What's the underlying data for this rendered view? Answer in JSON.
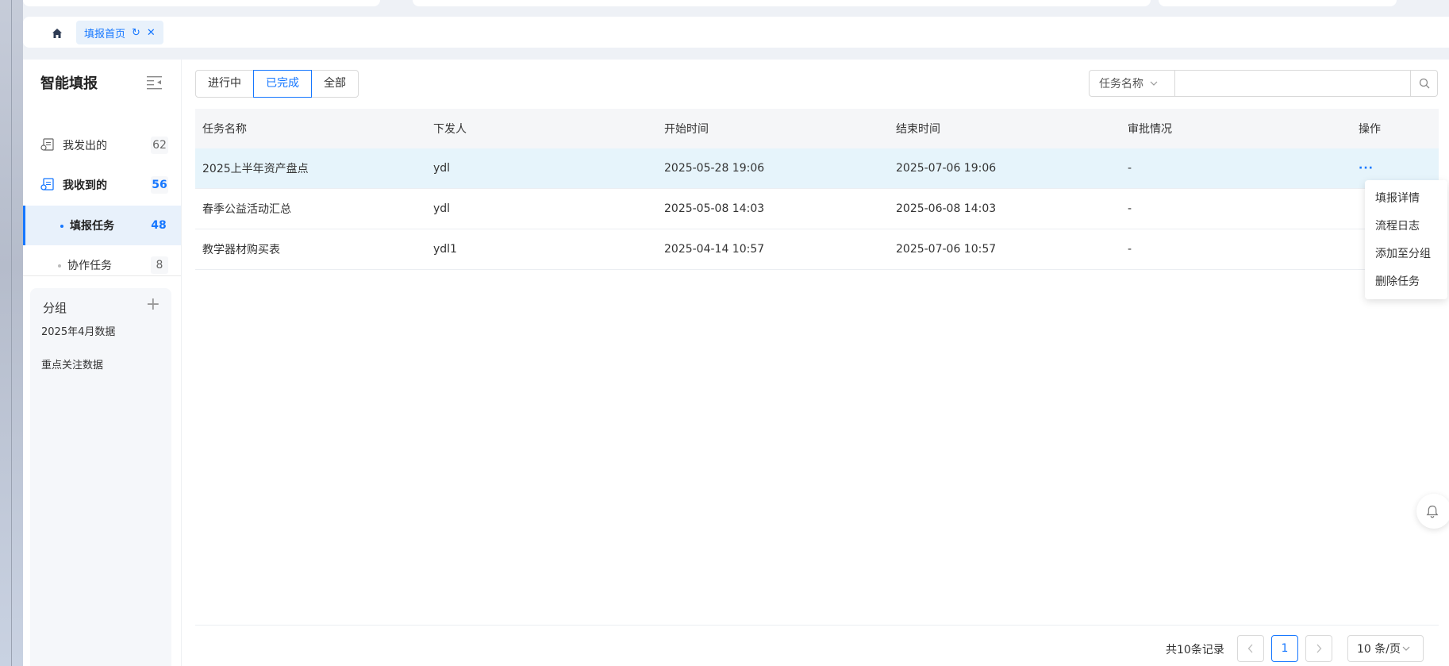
{
  "tabbar": {
    "home_icon": "home-icon",
    "active_tab": {
      "label": "填报首页",
      "refresh_icon": "refresh-icon",
      "close_icon": "close-icon"
    }
  },
  "sidebar": {
    "title": "智能填报",
    "collapse_icon": "menu-collapse-icon",
    "items": [
      {
        "label": "我发出的",
        "count": "62",
        "icon": "document-send-icon"
      },
      {
        "label": "我收到的",
        "count": "56",
        "icon": "document-receive-icon"
      },
      {
        "label": "填报任务",
        "count": "48"
      },
      {
        "label": "协作任务",
        "count": "8"
      }
    ],
    "groups": {
      "title": "分组",
      "add_icon": "plus-icon",
      "items": [
        "2025年4月数据",
        "重点关注数据"
      ]
    }
  },
  "toolbar": {
    "segments": [
      "进行中",
      "已完成",
      "全部"
    ],
    "selected_segment": "已完成",
    "search": {
      "field": "任务名称",
      "value": "",
      "placeholder": "",
      "search_icon": "search-icon"
    }
  },
  "table": {
    "columns": [
      "任务名称",
      "下发人",
      "开始时间",
      "结束时间",
      "审批情况",
      "操作"
    ],
    "rows": [
      {
        "name": "2025上半年资产盘点",
        "issuer": "ydl",
        "start": "2025-05-28 19:06",
        "end": "2025-07-06 19:06",
        "approval": "-",
        "action": "···"
      },
      {
        "name": "春季公益活动汇总",
        "issuer": "ydl",
        "start": "2025-05-08 14:03",
        "end": "2025-06-08 14:03",
        "approval": "-",
        "action": ""
      },
      {
        "name": "教学器材购买表",
        "issuer": "ydl1",
        "start": "2025-04-14 10:57",
        "end": "2025-07-06 10:57",
        "approval": "-",
        "action": ""
      }
    ]
  },
  "action_menu": [
    "填报详情",
    "流程日志",
    "添加至分组",
    "删除任务"
  ],
  "pagination": {
    "total_text": "共10条记录",
    "current_page": "1",
    "page_size": "10 条/页",
    "prev_icon": "chevron-left-icon",
    "next_icon": "chevron-right-icon"
  },
  "colors": {
    "accent": "#1677ff",
    "row_highlight": "#e6f4fb",
    "active_bg": "#e8f1fb"
  }
}
